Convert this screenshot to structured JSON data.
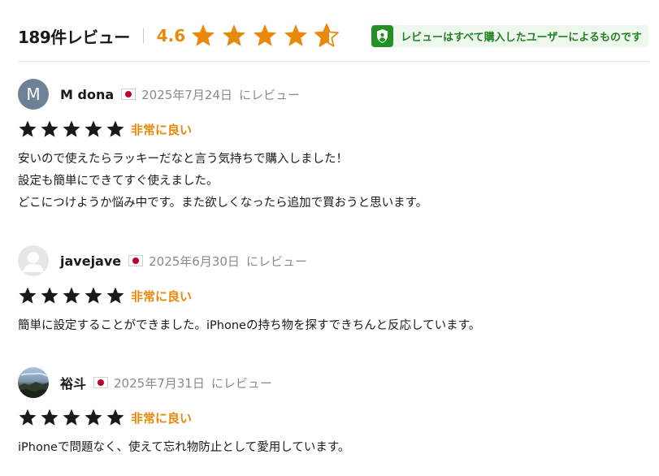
{
  "summary": {
    "count_label": "189件レビュー",
    "rating": "4.6",
    "stars": [
      1,
      1,
      1,
      1,
      0.6
    ],
    "badge_text": "レビューはすべて購入したユーザーによるものです",
    "badge_icon": "verified-user-icon"
  },
  "colors": {
    "accent_orange": "#e8890c",
    "star_dark": "#1a1a1a",
    "badge_green": "#239023",
    "flag_red": "#bc002d"
  },
  "reviews": [
    {
      "name": "M dona",
      "avatar_letter": "M",
      "flag_icon": "japan-flag-icon",
      "date": "2025年7月24日",
      "date_suffix": "にレビュー",
      "stars": 5,
      "rating_label": "非常に良い",
      "lines": [
        "安いので使えたらラッキーだなと言う気持ちで購入しました！",
        "設定も簡単にできてすぐ使えました。",
        "どこにつけようか悩み中です。また欲しくなったら追加で買おうと思います。"
      ]
    },
    {
      "name": "javejave",
      "avatar_icon": "default-user-icon",
      "flag_icon": "japan-flag-icon",
      "date": "2025年6月30日",
      "date_suffix": "にレビュー",
      "stars": 5,
      "rating_label": "非常に良い",
      "lines": [
        "簡単に設定することができました。iPhoneの持ち物を探すできちんと反応しています。"
      ]
    },
    {
      "name": "裕斗",
      "avatar_icon": "landscape-photo-avatar",
      "flag_icon": "japan-flag-icon",
      "date": "2025年7月31日",
      "date_suffix": "にレビュー",
      "stars": 5,
      "rating_label": "非常に良い",
      "lines": [
        "iPhoneで問題なく、使えて忘れ物防止として愛用しています。"
      ]
    }
  ]
}
